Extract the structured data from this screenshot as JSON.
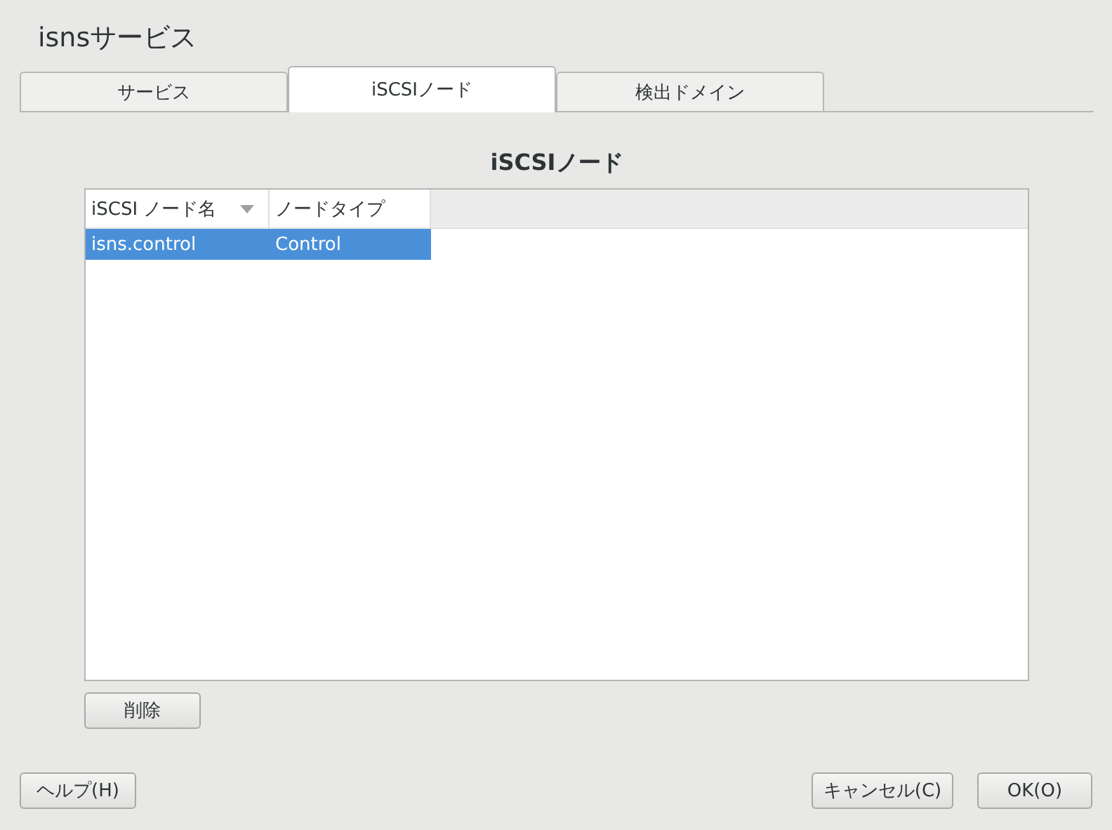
{
  "window": {
    "title": "isnsサービス"
  },
  "tabs": [
    {
      "label": "サービス",
      "selected": false
    },
    {
      "label": "iSCSIノード",
      "selected": true
    },
    {
      "label": "検出ドメイン",
      "selected": false
    }
  ],
  "heading": "iSCSIノード",
  "table": {
    "columns": [
      {
        "label": "iSCSI ノード名",
        "sorted": true
      },
      {
        "label": "ノードタイプ",
        "sorted": false
      }
    ],
    "rows": [
      {
        "cells": [
          "isns.control",
          "Control"
        ],
        "selected": true
      }
    ]
  },
  "delete_button": "削除",
  "buttons": {
    "help": "ヘルプ(H)",
    "cancel": "キャンセル(C)",
    "ok": "OK(O)"
  }
}
